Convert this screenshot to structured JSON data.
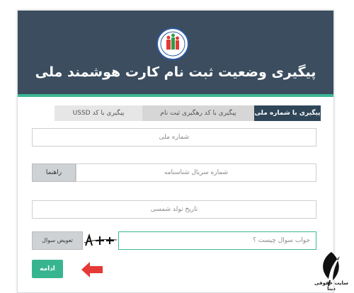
{
  "header": {
    "title": "پیگیری وضعیت ثبت نام کارت هوشمند ملی"
  },
  "tabs": [
    {
      "label": "پیگیری با شماره ملی"
    },
    {
      "label": "پیگیری با کد رهگیری ثبت نام"
    },
    {
      "label": "پیگیری با کد USSD"
    }
  ],
  "form": {
    "national_code_placeholder": "شماره ملی",
    "serial_placeholder": "شماره سریال شناسنامه",
    "help_label": "راهنما",
    "birthdate_placeholder": "تاریخ تولد شمسی",
    "captcha_placeholder": "جواب سوال چیست ؟",
    "change_question_label": "تعویض سوال",
    "submit_label": "ادامه"
  },
  "watermark": {
    "text": "سایت حقوقی دینا"
  },
  "colors": {
    "header": "#3b4d5f",
    "accent": "#3cb895",
    "arrow": "#e53935"
  }
}
